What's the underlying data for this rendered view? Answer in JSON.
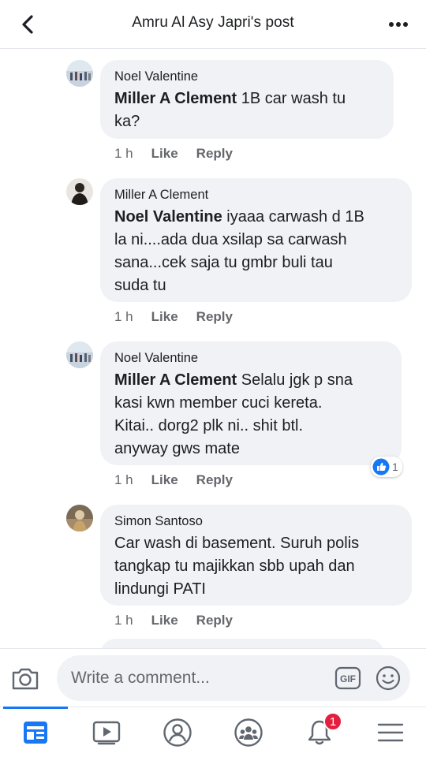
{
  "header": {
    "title": "Amru Al Asy Japri's post"
  },
  "comments": [
    {
      "author": "Noel Valentine",
      "mention": "Miller A Clement",
      "text_lines": [
        " 1B car wash tu",
        "ka?"
      ],
      "time": "1 h",
      "like": "Like",
      "reply": "Reply"
    },
    {
      "author": "Miller A Clement",
      "mention": "Noel Valentine",
      "text_lines": [
        " iyaaa carwash d 1B",
        "la ni....ada dua xsilap sa carwash",
        "sana...cek saja tu gmbr buli tau",
        "suda tu"
      ],
      "time": "1 h",
      "like": "Like",
      "reply": "Reply"
    },
    {
      "author": "Noel Valentine",
      "mention": "Miller A Clement",
      "text_lines": [
        " Selalu jgk p sna",
        "kasi kwn member cuci kereta.",
        "Kitai.. dorg2 plk ni.. shit btl.",
        "anyway gws mate"
      ],
      "time": "1 h",
      "like": "Like",
      "reply": "Reply",
      "reaction_count": "1"
    },
    {
      "author": "Simon Santoso",
      "mention": "",
      "text_lines": [
        "Car wash di basement. Suruh polis",
        "tangkap tu majikkan sbb upah dan",
        "lindungi PATI"
      ],
      "time": "1 h",
      "like": "Like",
      "reply": "Reply"
    }
  ],
  "composer": {
    "placeholder": "Write a comment..."
  },
  "tabbar": {
    "notifications_badge": "1"
  },
  "colors": {
    "accent": "#1877f2",
    "bubble": "#f0f2f5",
    "meta": "#65676b",
    "badge": "#e41e3f"
  }
}
